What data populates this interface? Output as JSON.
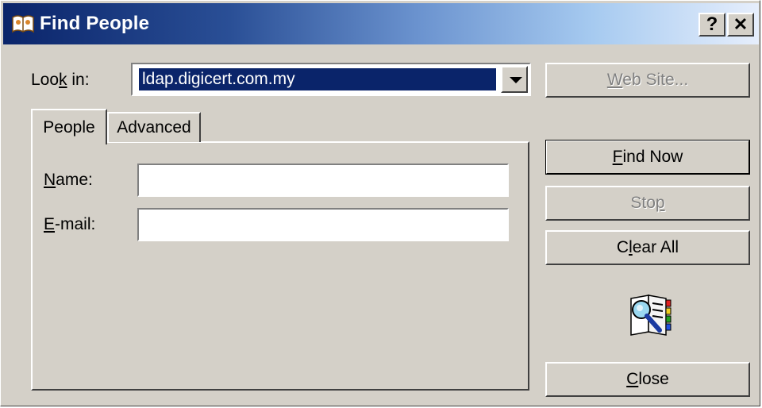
{
  "window": {
    "title": "Find People",
    "help_label": "?",
    "close_label": "✕"
  },
  "look_in": {
    "label_pre": "Loo",
    "label_hot": "k",
    "label_post": " in:",
    "value": "ldap.digicert.com.my"
  },
  "buttons": {
    "web_site": {
      "hot": "W",
      "rest": "eb Site..."
    },
    "find_now": {
      "hot": "F",
      "rest": "ind Now"
    },
    "stop": {
      "pre": "Sto",
      "hot": "p"
    },
    "clear_all": {
      "pre": "C",
      "hot": "l",
      "rest": "ear All"
    },
    "close": {
      "hot": "C",
      "rest": "lose"
    }
  },
  "tabs": {
    "people": "People",
    "advanced": "Advanced"
  },
  "fields": {
    "name": {
      "hot": "N",
      "rest": "ame:",
      "value": ""
    },
    "email": {
      "hot": "E",
      "rest": "-mail:",
      "value": ""
    }
  },
  "colors": {
    "title_bar_start": "#0a246a",
    "title_bar_end": "#a6caf0",
    "selection": "#0a246a",
    "face": "#d4d0c8"
  },
  "icons": {
    "app": "book-people-icon",
    "find": "address-book-search-icon"
  }
}
